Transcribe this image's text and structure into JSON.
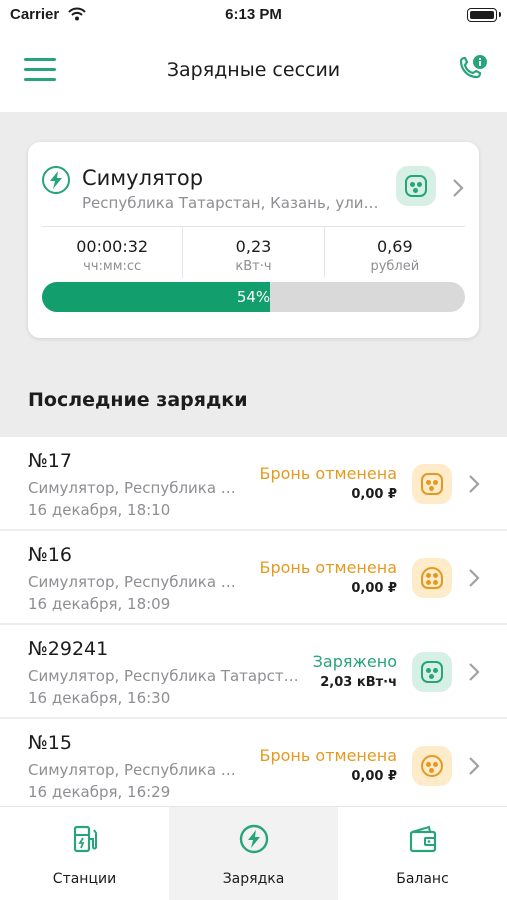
{
  "status_bar": {
    "carrier": "Carrier",
    "time": "6:13 PM"
  },
  "header": {
    "title": "Зарядные сессии"
  },
  "active_session": {
    "title": "Симулятор",
    "address": "Республика Татарстан, Казань, ули…",
    "stats": [
      {
        "value": "00:00:32",
        "unit": "чч:мм:сс"
      },
      {
        "value": "0,23",
        "unit": "кВт·ч"
      },
      {
        "value": "0,69",
        "unit": "рублей"
      }
    ],
    "progress_label": "54%",
    "progress_fraction": 0.54
  },
  "section_title": "Последние зарядки",
  "colors": {
    "accent": "#27a47a",
    "orange": "#e49a21",
    "progress": "#129e6d"
  },
  "sessions": [
    {
      "number": "№17",
      "subtitle": "Симулятор, Республика …",
      "date": "16 декабря, 18:10",
      "status": "Бронь отменена",
      "amount": "0,00 ₽",
      "kind": "orange"
    },
    {
      "number": "№16",
      "subtitle": "Симулятор, Республика …",
      "date": "16 декабря, 18:09",
      "status": "Бронь отменена",
      "amount": "0,00 ₽",
      "kind": "orange"
    },
    {
      "number": "№29241",
      "subtitle": "Симулятор, Республика Татарст…",
      "date": "16 декабря, 16:30",
      "status": "Заряжено",
      "amount": "2,03 кВт·ч",
      "kind": "green"
    },
    {
      "number": "№15",
      "subtitle": "Симулятор, Республика …",
      "date": "16 декабря, 16:29",
      "status": "Бронь отменена",
      "amount": "0,00 ₽",
      "kind": "orange"
    }
  ],
  "tabs": [
    {
      "label": "Станции",
      "icon": "charging-station-icon"
    },
    {
      "label": "Зарядка",
      "icon": "bolt-icon"
    },
    {
      "label": "Баланс",
      "icon": "wallet-icon"
    }
  ]
}
